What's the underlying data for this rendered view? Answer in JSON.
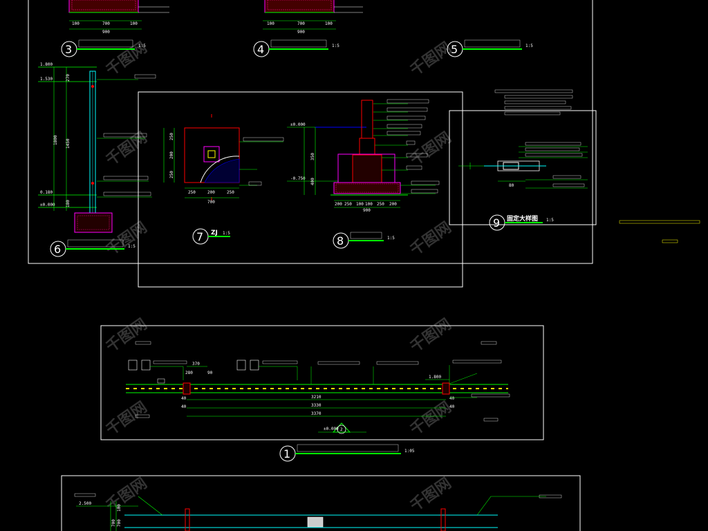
{
  "details": {
    "d3": {
      "num": "3",
      "scale": "1:5",
      "dims": [
        "100",
        "700",
        "100",
        "900"
      ]
    },
    "d4": {
      "num": "4",
      "scale": "1:5",
      "dims": [
        "100",
        "700",
        "100",
        "900"
      ]
    },
    "d5": {
      "num": "5",
      "scale": "1:5"
    },
    "d6": {
      "num": "6",
      "scale": "1:5",
      "elevs": [
        "1.800",
        "1.530",
        "0.180",
        "±0.000"
      ],
      "dims": [
        "270",
        "1800",
        "1450",
        "180"
      ]
    },
    "d7": {
      "num": "7",
      "label": "ZJ",
      "scale": "1:5",
      "dims": [
        "250",
        "200",
        "250",
        "700"
      ],
      "side": [
        "250",
        "200",
        "250"
      ]
    },
    "d8": {
      "num": "8",
      "scale": "1:5",
      "elevs": [
        "±0.000",
        "-0.750"
      ],
      "dims": [
        "200",
        "250",
        "100",
        "100",
        "250",
        "200",
        "900"
      ],
      "side": [
        "350",
        "400"
      ]
    },
    "d9": {
      "num": "9",
      "label": "固定大样图",
      "scale": "1:5",
      "dims": [
        "80"
      ]
    }
  },
  "plan1": {
    "num": "1",
    "scale": "1:05",
    "dims": [
      "370",
      "3210",
      "3330",
      "3370",
      "40",
      "40",
      "40",
      "40"
    ],
    "elevs": [
      "1.800",
      "±0.000"
    ],
    "marker": "2",
    "top_dims": [
      "280",
      "90"
    ]
  },
  "bottom_section": {
    "elevs": [
      "2.500"
    ],
    "dims": [
      "700",
      "700",
      "100"
    ]
  },
  "watermark": "千图网"
}
